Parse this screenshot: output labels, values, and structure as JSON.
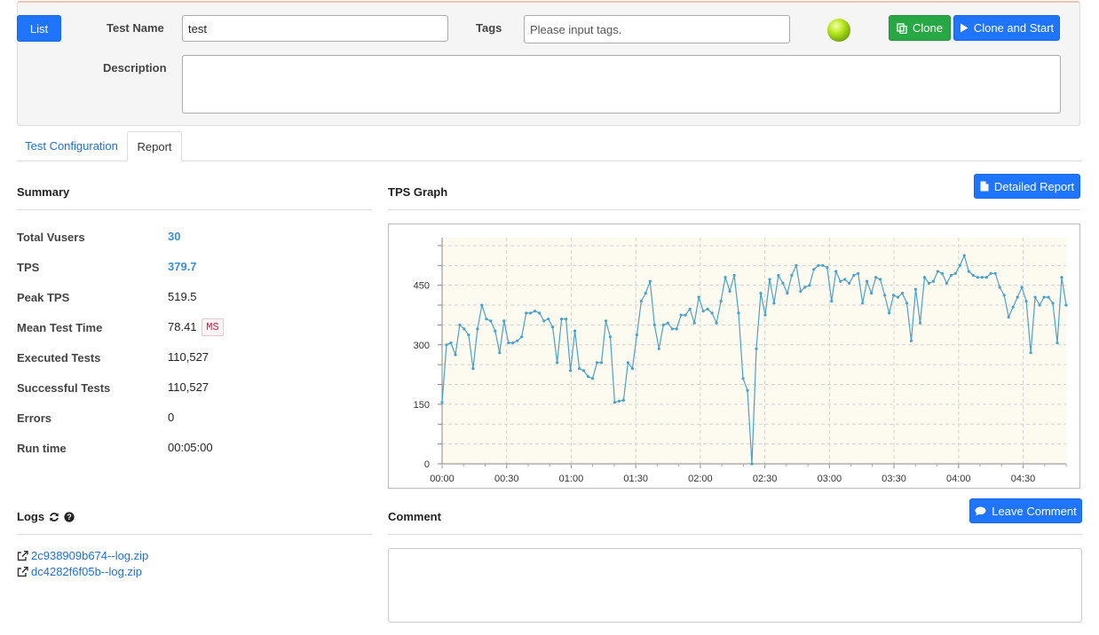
{
  "header": {
    "list_label": "List",
    "test_name_label": "Test Name",
    "test_name_value": "test",
    "tags_label": "Tags",
    "tags_placeholder": "Please input tags.",
    "description_label": "Description",
    "description_value": "",
    "status_color": "#8fd014",
    "clone_label": "Clone",
    "clone_start_label": "Clone and Start"
  },
  "tabs": [
    {
      "label": "Test Configuration",
      "active": false
    },
    {
      "label": "Report",
      "active": true
    }
  ],
  "summary": {
    "title": "Summary",
    "rows": [
      {
        "label": "Total Vusers",
        "value": "30"
      },
      {
        "label": "TPS",
        "value": "379.7"
      },
      {
        "label": "Peak TPS",
        "value": "519.5"
      },
      {
        "label": "Mean Test Time",
        "value": "78.41",
        "unit": "MS"
      },
      {
        "label": "Executed Tests",
        "value": "110,527"
      },
      {
        "label": "Successful Tests",
        "value": "110,527"
      },
      {
        "label": "Errors",
        "value": "0"
      },
      {
        "label": "Run time",
        "value": "00:05:00"
      }
    ]
  },
  "tps_graph": {
    "title": "TPS Graph",
    "detailed_report_label": "Detailed Report"
  },
  "logs": {
    "title": "Logs",
    "files": [
      "2c938909b674--log.zip",
      "dc4282f6f05b--log.zip"
    ]
  },
  "comment": {
    "title": "Comment",
    "leave_comment_label": "Leave Comment",
    "value": ""
  },
  "colors": {
    "primary": "#1f75ff",
    "success": "#28a745",
    "line": "#4aa3c7",
    "plot_bg": "#fdfaf0",
    "accent_value": "#3a8fd0"
  },
  "chart_data": {
    "type": "line",
    "title": "",
    "xlabel": "",
    "ylabel": "",
    "x_unit": "seconds",
    "xlim": [
      0,
      290
    ],
    "ylim": [
      0,
      570
    ],
    "yticks": [
      0,
      150,
      300,
      450
    ],
    "xticks": [
      {
        "value": 0,
        "label": "00:00"
      },
      {
        "value": 30,
        "label": "00:30"
      },
      {
        "value": 60,
        "label": "01:00"
      },
      {
        "value": 90,
        "label": "01:30"
      },
      {
        "value": 120,
        "label": "02:00"
      },
      {
        "value": 150,
        "label": "02:30"
      },
      {
        "value": 180,
        "label": "03:00"
      },
      {
        "value": 210,
        "label": "03:30"
      },
      {
        "value": 240,
        "label": "04:00"
      },
      {
        "value": 270,
        "label": "04:30"
      }
    ],
    "grid": true,
    "series": [
      {
        "values": [
          155,
          300,
          305,
          275,
          350,
          340,
          325,
          240,
          340,
          400,
          365,
          360,
          335,
          280,
          360,
          305,
          305,
          310,
          320,
          380,
          380,
          385,
          380,
          360,
          365,
          345,
          255,
          365,
          365,
          235,
          335,
          240,
          235,
          220,
          215,
          255,
          255,
          360,
          320,
          155,
          158,
          160,
          255,
          240,
          325,
          410,
          430,
          460,
          350,
          290,
          350,
          355,
          340,
          340,
          375,
          375,
          390,
          355,
          420,
          385,
          390,
          380,
          355,
          410,
          470,
          435,
          475,
          380,
          215,
          185,
          0,
          290,
          430,
          375,
          465,
          405,
          475,
          455,
          430,
          475,
          500,
          435,
          445,
          450,
          490,
          500,
          500,
          495,
          410,
          485,
          460,
          465,
          455,
          475,
          480,
          405,
          460,
          430,
          470,
          465,
          425,
          380,
          425,
          420,
          430,
          405,
          310,
          440,
          355,
          470,
          455,
          460,
          485,
          480,
          455,
          475,
          480,
          500,
          525,
          485,
          475,
          470,
          470,
          470,
          480,
          480,
          445,
          425,
          370,
          395,
          420,
          445,
          410,
          280,
          420,
          400,
          420,
          420,
          405,
          305,
          470,
          400
        ]
      }
    ]
  }
}
